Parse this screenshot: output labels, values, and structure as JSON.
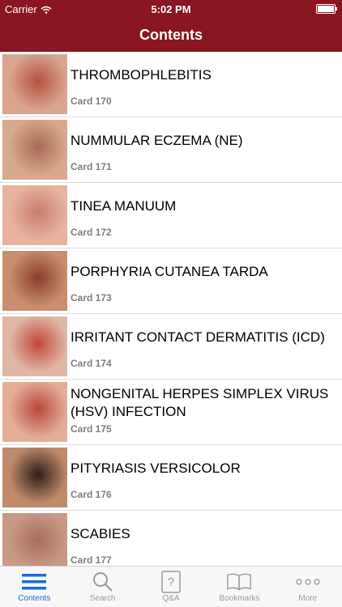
{
  "status": {
    "carrier": "Carrier",
    "time": "5:02 PM"
  },
  "nav": {
    "title": "Contents"
  },
  "items": [
    {
      "name": "THROMBOPHLEBITIS",
      "card": "Card 170",
      "skin": "#d9a58f",
      "spot": "#b5503f"
    },
    {
      "name": "NUMMULAR ECZEMA (NE)",
      "card": "Card 171",
      "skin": "#d8a98c",
      "spot": "#a86a55"
    },
    {
      "name": "TINEA MANUUM",
      "card": "Card 172",
      "skin": "#e7b3a0",
      "spot": "#c97e6e"
    },
    {
      "name": "PORPHYRIA CUTANEA TARDA",
      "card": "Card 173",
      "skin": "#c88e6e",
      "spot": "#8a3e2a"
    },
    {
      "name": "IRRITANT CONTACT DERMATITIS (ICD)",
      "card": "Card 174",
      "skin": "#e0b7a6",
      "spot": "#c0473b"
    },
    {
      "name": "NONGENITAL HERPES SIMPLEX VIRUS (HSV) INFECTION",
      "card": "Card 175",
      "skin": "#e3ad98",
      "spot": "#b9473b"
    },
    {
      "name": "PITYRIASIS VERSICOLOR",
      "card": "Card 176",
      "skin": "#c08a6b",
      "spot": "#2c1e18"
    },
    {
      "name": "SCABIES",
      "card": "Card 177",
      "skin": "#c99985",
      "spot": "#a96d5d"
    }
  ],
  "tabs": [
    {
      "label": "Contents",
      "icon": "list-icon",
      "active": true
    },
    {
      "label": "Search",
      "icon": "search-icon",
      "active": false
    },
    {
      "label": "Q&A",
      "icon": "question-card-icon",
      "active": false
    },
    {
      "label": "Bookmarks",
      "icon": "book-icon",
      "active": false
    },
    {
      "label": "More",
      "icon": "more-icon",
      "active": false
    }
  ],
  "colors": {
    "nav": "#891620",
    "tab_active": "#1a6dd4",
    "tab_inactive": "#9a9a9a"
  }
}
